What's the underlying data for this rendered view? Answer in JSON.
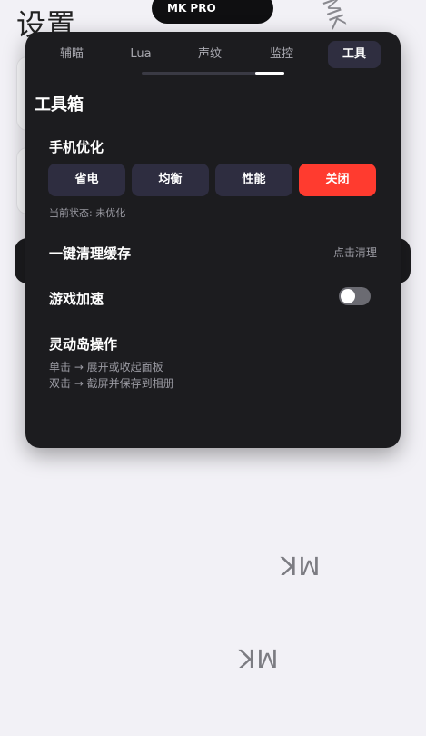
{
  "background": {
    "title": "设置",
    "watermarks": [
      "MK",
      "MK",
      "MK"
    ]
  },
  "pill": {
    "label": "MK PRO"
  },
  "tabs": [
    {
      "label": "辅瞄",
      "active": false
    },
    {
      "label": "Lua",
      "active": false
    },
    {
      "label": "声纹",
      "active": false
    },
    {
      "label": "监控",
      "active": false
    },
    {
      "label": "工具",
      "active": true
    }
  ],
  "panel": {
    "section_title": "工具箱",
    "phone_opt": {
      "label": "手机优化",
      "buttons": [
        "省电",
        "均衡",
        "性能",
        "关闭"
      ],
      "active_button": "关闭",
      "status": "当前状态: 未优化"
    },
    "cache": {
      "label": "一键清理缓存",
      "action": "点击清理"
    },
    "game_boost": {
      "label": "游戏加速",
      "enabled": false
    },
    "island": {
      "label": "灵动岛操作",
      "line1": "单击 → 展开或收起面板",
      "line2": "双击 → 截屏并保存到相册"
    }
  },
  "colors": {
    "accent_active": "#ff3b2f",
    "panel_bg": "#1c1c1f",
    "button_bg": "#2e2d40"
  }
}
